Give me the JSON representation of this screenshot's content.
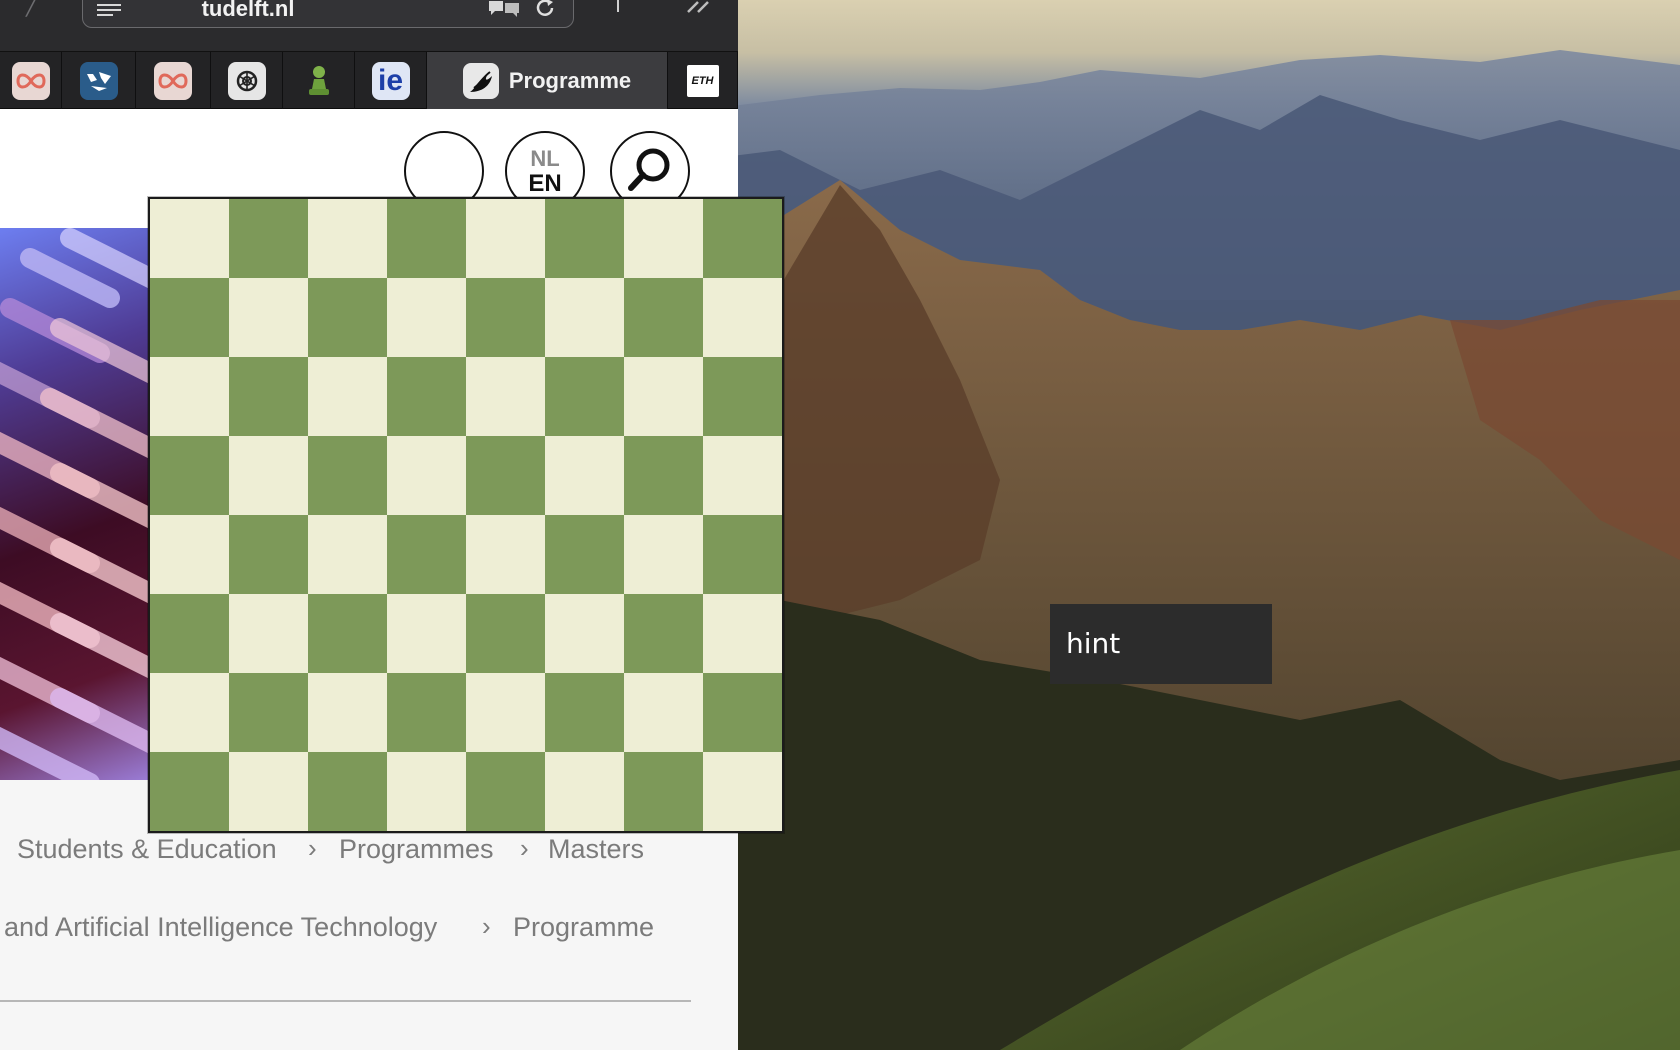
{
  "browser": {
    "url": "tudelft.nl",
    "tabs": [
      {
        "name": "tab-infinity-1",
        "icon": "infinity-icon"
      },
      {
        "name": "tab-app-blue",
        "icon": "app-blue-icon"
      },
      {
        "name": "tab-infinity-2",
        "icon": "infinity-icon"
      },
      {
        "name": "tab-openai",
        "icon": "openai-icon"
      },
      {
        "name": "tab-chess",
        "icon": "chess-pawn-icon"
      },
      {
        "name": "tab-ie",
        "icon": "ie-icon",
        "fav_text": "ie"
      },
      {
        "name": "tab-programme",
        "icon": "tudelft-flame-icon",
        "label": "Programme",
        "active": true
      },
      {
        "name": "tab-eth",
        "icon": "eth-icon",
        "fav_text": "ETH"
      }
    ]
  },
  "page": {
    "lang": {
      "nl": "NL",
      "en": "EN"
    },
    "breadcrumbs": {
      "line1": [
        "Students & Education",
        "Programmes",
        "Masters"
      ],
      "line2": [
        "and Artificial Intelligence Technology",
        "Programme"
      ]
    }
  },
  "chessboard": {
    "rows": 8,
    "cols": 8,
    "light_color": "#eeeed5",
    "dark_color": "#7d9959"
  },
  "hint": {
    "label": "hint"
  }
}
